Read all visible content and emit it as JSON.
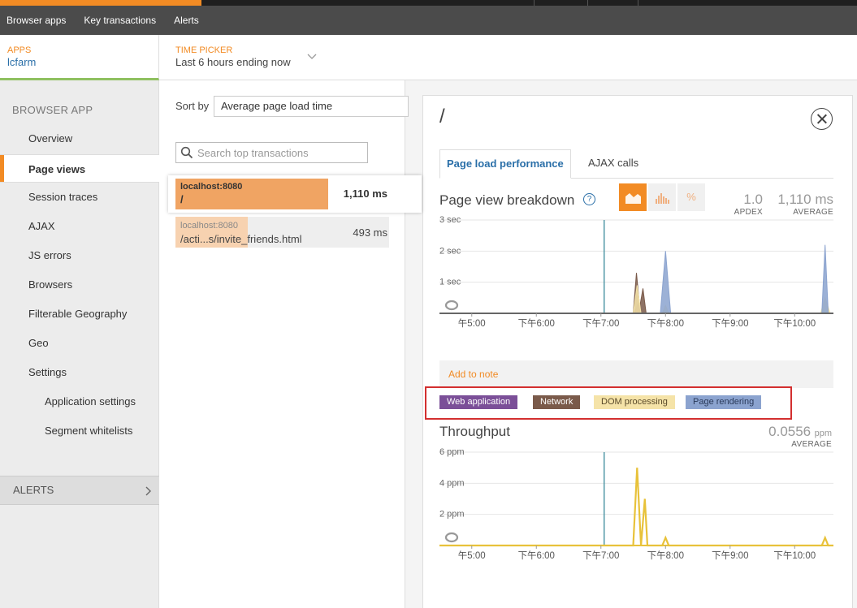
{
  "nav": {
    "items": [
      "Browser apps",
      "Key transactions",
      "Alerts"
    ]
  },
  "header": {
    "apps_label": "APPS",
    "apps_value": "lcfarm",
    "timepicker_label": "TIME PICKER",
    "timepicker_value": "Last 6 hours ending now"
  },
  "sidebar": {
    "title": "BROWSER APP",
    "items": [
      {
        "label": "Overview"
      },
      {
        "label": "Page views"
      },
      {
        "label": "Session traces"
      },
      {
        "label": "AJAX"
      },
      {
        "label": "JS errors"
      },
      {
        "label": "Browsers"
      },
      {
        "label": "Filterable Geography"
      },
      {
        "label": "Geo"
      },
      {
        "label": "Settings"
      },
      {
        "label": "Application settings"
      },
      {
        "label": "Segment whitelists"
      }
    ],
    "alerts_label": "ALERTS"
  },
  "list": {
    "sort_label": "Sort by",
    "sort_value": "Average page load time",
    "search_placeholder": "Search top transactions",
    "rows": [
      {
        "host": "localhost:8080",
        "path": "/",
        "value": "1,110 ms",
        "fraction": 1.0
      },
      {
        "host": "localhost:8080",
        "path": "/acti...s/invite_friends.html",
        "value": "493 ms",
        "fraction": 0.444
      }
    ]
  },
  "detail": {
    "title": "/",
    "tabs": [
      "Page load performance",
      "AJAX calls"
    ],
    "breakdown_title": "Page view breakdown",
    "help_glyph": "?",
    "percent_glyph": "%",
    "apdex_value": "1.0",
    "apdex_label": "APDEX",
    "avg_value": "1,110 ms",
    "avg_label": "AVERAGE",
    "add_note": "Add to note",
    "throughput_title": "Throughput",
    "throughput_value": "0.0556",
    "throughput_unit": "ppm",
    "throughput_label": "AVERAGE"
  },
  "colors": {
    "web_application": "#7b4f98",
    "network": "#7a5a4a",
    "dom_processing": "#f5e3a8",
    "page_rendering": "#8ba3cf",
    "throughput": "#e8c23a",
    "accent": "#f28b24"
  },
  "chart_data": [
    {
      "type": "area",
      "x_tick_labels": [
        "午5:00",
        "下午6:00",
        "下午7:00",
        "下午8:00",
        "下午9:00",
        "下午10:00"
      ],
      "y_tick_labels": [
        "1 sec",
        "2 sec",
        "3 sec"
      ],
      "ylim": [
        0,
        3
      ],
      "xlim": [
        0,
        6.1
      ],
      "marker_x": 2.55,
      "legend": [
        "Web application",
        "Network",
        "DOM processing",
        "Page rendering"
      ],
      "series": [
        {
          "name": "Web application",
          "x": [
            0,
            3.02,
            3.07,
            3.12,
            6.1
          ],
          "values": [
            0,
            0,
            0.3,
            0,
            0
          ]
        },
        {
          "name": "Network",
          "x": [
            0,
            3.0,
            3.05,
            3.1,
            3.15,
            3.2,
            6.1
          ],
          "values": [
            0,
            0,
            1.3,
            0.2,
            0.8,
            0,
            0
          ]
        },
        {
          "name": "DOM processing",
          "x": [
            0,
            3.0,
            3.06,
            3.12,
            3.45,
            3.5,
            3.55,
            5.9,
            5.97,
            6.05,
            6.1
          ],
          "values": [
            0,
            0,
            0.9,
            0,
            0,
            0.25,
            0,
            0,
            0.5,
            0,
            0
          ]
        },
        {
          "name": "Page rendering",
          "x": [
            0,
            3.42,
            3.5,
            3.58,
            5.92,
            5.97,
            6.02,
            6.1
          ],
          "values": [
            0,
            0,
            2.0,
            0,
            0,
            2.2,
            0,
            0
          ]
        }
      ]
    },
    {
      "type": "line",
      "title": "Throughput",
      "x_tick_labels": [
        "午5:00",
        "下午6:00",
        "下午7:00",
        "下午8:00",
        "下午9:00",
        "下午10:00"
      ],
      "y_tick_labels": [
        "2 ppm",
        "4 ppm",
        "6 ppm"
      ],
      "ylim": [
        0,
        6
      ],
      "xlim": [
        0,
        6.1
      ],
      "marker_x": 2.55,
      "series": [
        {
          "name": "Throughput",
          "x": [
            0,
            3.0,
            3.06,
            3.12,
            3.18,
            3.22,
            3.28,
            3.45,
            3.5,
            3.55,
            5.92,
            5.97,
            6.02,
            6.1
          ],
          "values": [
            0,
            0,
            5.0,
            0,
            3.0,
            0,
            0,
            0,
            0.5,
            0,
            0,
            0.5,
            0,
            0
          ]
        }
      ]
    }
  ]
}
